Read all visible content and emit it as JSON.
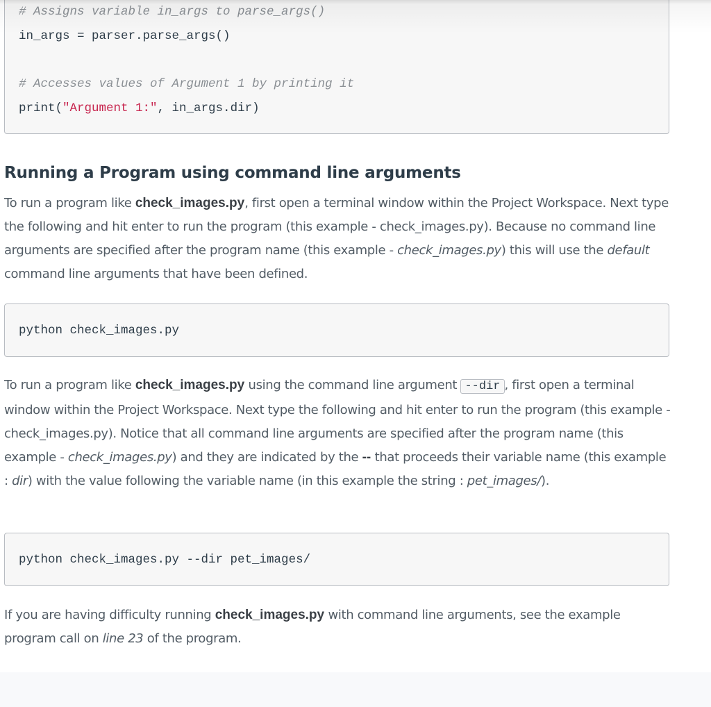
{
  "code_block_1": {
    "lines": [
      {
        "type": "comment",
        "text": "# Assigns variable in_args to parse_args()"
      },
      {
        "type": "code",
        "text": "in_args = parser.parse_args()"
      },
      {
        "type": "blank",
        "text": ""
      },
      {
        "type": "comment",
        "text": "# Accesses values of Argument 1 by printing it"
      },
      {
        "type": "code_print",
        "prefix": "print(",
        "string": "\"Argument 1:\"",
        "suffix": ", in_args.dir)"
      }
    ]
  },
  "section": {
    "title": "Running a Program using command line arguments",
    "para1": {
      "t1": "To run a program like ",
      "b1": "check_images.py",
      "t2": ", first open a terminal window within the Project Workspace. Next type the following and hit enter to run the program (this example - check_images.py). Because no command line arguments are specified after the program name (this example - ",
      "i1": "check_images.py",
      "t3": ") this will use the ",
      "i2": "default",
      "t4": " command line arguments that have been defined."
    },
    "code_block_2": "python check_images.py",
    "para2": {
      "t1": "To run a program like ",
      "b1": "check_images.py",
      "t2": " using the command line argument ",
      "code1": "--dir",
      "t3": ", first open a terminal window within the Project Workspace. Next type the following and hit enter to run the program (this example - check_images.py). Notice that all command line arguments are specified after the program name (this example - ",
      "i1": "check_images.py",
      "t4": ") and they are indicated by the ",
      "b2": "--",
      "t5": " that proceeds their variable name (this example : ",
      "i2": "dir",
      "t6": ") with the value following the variable name (in this example the string : ",
      "i3": "pet_images/",
      "t7": ")."
    },
    "code_block_3": "python check_images.py --dir pet_images/",
    "para3": {
      "t1": "If you are having difficulty running ",
      "b1": "check_images.py",
      "t2": " with command line arguments, see the example program call on ",
      "i1": "line 23",
      "t3": " of the program."
    }
  }
}
